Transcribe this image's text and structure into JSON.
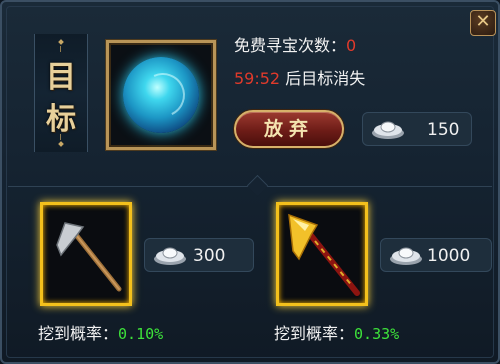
{
  "panel": {
    "title_chars": [
      "目",
      "标"
    ]
  },
  "target": {
    "icon": "blue-orb-icon",
    "free_count_label": "免费寻宝次数：",
    "free_count_value": "0",
    "timer_value": "59:52",
    "timer_suffix": "后目标消失",
    "abandon_label": "放弃",
    "abandon_cost": "150"
  },
  "tools": [
    {
      "icon": "hoe-icon",
      "cost": "300",
      "rate_label": "挖到概率：",
      "rate_value": "0.10%"
    },
    {
      "icon": "golden-hoe-icon",
      "cost": "1000",
      "rate_label": "挖到概率：",
      "rate_value": "0.33%"
    }
  ],
  "colors": {
    "highlight_red": "#e03a2b",
    "rate_green": "#3de23a",
    "frame_gold": "#f3c01c"
  }
}
